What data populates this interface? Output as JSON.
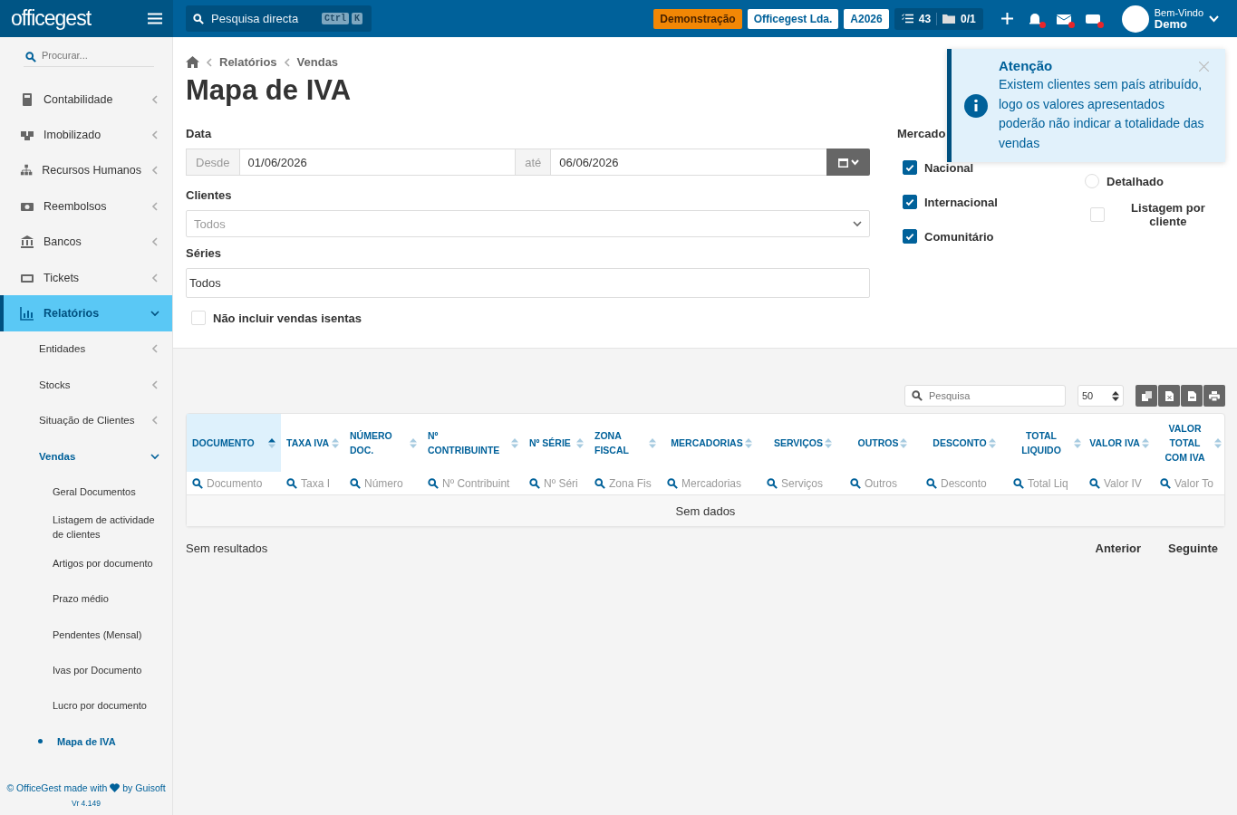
{
  "topbar": {
    "logo": "officegest",
    "search": {
      "placeholder": "Pesquisa directa",
      "keys": [
        "Ctrl",
        "K"
      ]
    },
    "badges": [
      {
        "label": "Demonstração",
        "kind": "demo"
      },
      {
        "label": "Officegest Lda.",
        "kind": "company"
      },
      {
        "label": "A2026",
        "kind": "company"
      }
    ],
    "counters": [
      "43",
      "0/1"
    ],
    "user": {
      "greeting": "Bem-Vindo",
      "name": "Demo"
    }
  },
  "sidebar": {
    "search": {
      "placeholder": "Procurar..."
    },
    "items": [
      {
        "label": "Contabilidade",
        "expanded": false,
        "selected": false
      },
      {
        "label": "Imobilizado",
        "expanded": false,
        "selected": false
      },
      {
        "label": "Recursos Humanos",
        "expanded": false,
        "selected": false
      },
      {
        "label": "Reembolsos",
        "expanded": false,
        "selected": false
      },
      {
        "label": "Bancos",
        "expanded": false,
        "selected": false
      },
      {
        "label": "Tickets",
        "expanded": false,
        "selected": false
      },
      {
        "label": "Relatórios",
        "expanded": true,
        "selected": true,
        "children": [
          {
            "label": "Entidades",
            "expanded": false,
            "selected": false
          },
          {
            "label": "Stocks",
            "expanded": false,
            "selected": false
          },
          {
            "label": "Situação de Clientes",
            "expanded": false,
            "selected": false
          },
          {
            "label": "Vendas",
            "expanded": true,
            "selected": true,
            "children": [
              {
                "label": "Geral Documentos",
                "selected": false
              },
              {
                "label": "Listagem de actividade de clientes",
                "selected": false
              },
              {
                "label": "Artigos por documento",
                "selected": false
              },
              {
                "label": "Prazo médio",
                "selected": false
              },
              {
                "label": "Pendentes (Mensal)",
                "selected": false
              },
              {
                "label": "Ivas por Documento",
                "selected": false
              },
              {
                "label": "Lucro por documento",
                "selected": false
              },
              {
                "label": "Mapa de IVA",
                "selected": true
              }
            ]
          }
        ]
      }
    ],
    "footer": {
      "left": "© OfficeGest made with",
      "right": "by Guisoft",
      "version": "Vr 4.149"
    }
  },
  "breadcrumb": [
    "Relatórios",
    "Vendas"
  ],
  "title": "Mapa de IVA",
  "form": {
    "date_label": "Data",
    "from_label": "Desde",
    "from": "01/06/2026",
    "to_label": "até",
    "to": "06/06/2026",
    "clients_label": "Clientes",
    "clients": "Todos",
    "series_label": "Séries",
    "series": "Todos",
    "exclude": {
      "label": "Não incluir vendas isentas",
      "checked": false
    },
    "market_label": "Mercado",
    "markets": [
      {
        "label": "Nacional",
        "checked": true
      },
      {
        "label": "Internacional",
        "checked": true
      },
      {
        "label": "Comunitário",
        "checked": true
      }
    ],
    "detail": {
      "label": "Detalhado",
      "selected": false
    },
    "per_client": {
      "label": "Listagem por cliente",
      "checked": false
    }
  },
  "toast": {
    "title": "Atenção",
    "message": "Existem clientes sem país atribuído, logo os valores apresentados poderão não indicar a totalidade das vendas"
  },
  "table_tools": {
    "search": {
      "placeholder": "Pesquisa"
    },
    "page_size": "50"
  },
  "table": {
    "columns": [
      {
        "label": "DOCUMENTO",
        "placeholder": "Documento",
        "sorted": true
      },
      {
        "label": "TAXA IVA",
        "placeholder": "Taxa I",
        "sorted": false
      },
      {
        "label": "NÚMERO DOC.",
        "placeholder": "Número",
        "sorted": false
      },
      {
        "label": "Nº CONTRIBUINTE",
        "placeholder": "Nº Contribuint",
        "sorted": false
      },
      {
        "label": "Nº SÉRIE",
        "placeholder": "Nº Séri",
        "sorted": false
      },
      {
        "label": "ZONA FISCAL",
        "placeholder": "Zona Fis",
        "sorted": false
      },
      {
        "label": "MERCADORIAS",
        "placeholder": "Mercadorias",
        "sorted": false
      },
      {
        "label": "SERVIÇOS",
        "placeholder": "Serviços",
        "sorted": false
      },
      {
        "label": "OUTROS",
        "placeholder": "Outros",
        "sorted": false
      },
      {
        "label": "DESCONTO",
        "placeholder": "Desconto",
        "sorted": false
      },
      {
        "label": "TOTAL LIQUIDO",
        "placeholder": "Total Liq",
        "sorted": false
      },
      {
        "label": "VALOR IVA",
        "placeholder": "Valor IV",
        "sorted": false
      },
      {
        "label": "VALOR TOTAL COM IVA",
        "placeholder": "Valor To",
        "sorted": false
      }
    ],
    "empty": "Sem dados"
  },
  "pager": {
    "info": "Sem resultados",
    "prev": "Anterior",
    "next": "Seguinte"
  }
}
